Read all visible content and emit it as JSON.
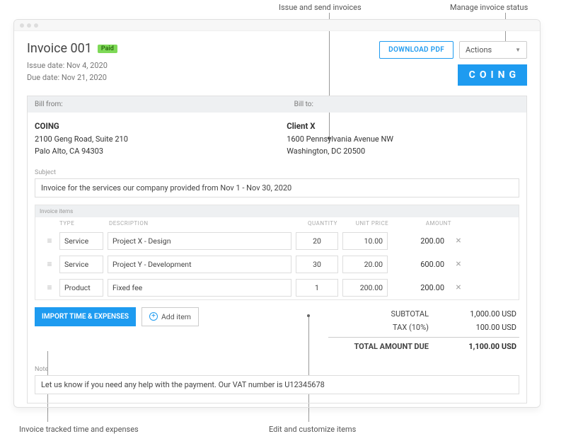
{
  "annotations": {
    "issue_send": "Issue and send invoices",
    "manage_status": "Manage invoice status",
    "tracked": "Invoice tracked time and expenses",
    "edit_items": "Edit and customize items"
  },
  "header": {
    "title": "Invoice 001",
    "status_badge": "Paid",
    "issue_date": "Issue date: Nov 4, 2020",
    "due_date": "Due date: Nov 21, 2020",
    "download_label": "DOWNLOAD PDF",
    "actions_label": "Actions",
    "logo": "COING"
  },
  "bill": {
    "from_label": "Bill from:",
    "to_label": "Bill to:",
    "from_name": "COING",
    "from_line1": "2100 Geng Road, Suite 210",
    "from_line2": "Palo Alto, CA 94303",
    "to_name": "Client X",
    "to_line1": "1600 Pennsylvania Avenue NW",
    "to_line2": "Washington, DC 20500"
  },
  "subject": {
    "label": "Subject",
    "value": "Invoice for the services our company provided from Nov 1 - Nov 30, 2020"
  },
  "items": {
    "section_label": "Invoice items",
    "cols": {
      "type": "TYPE",
      "desc": "DESCRIPTION",
      "qty": "QUANTITY",
      "price": "UNIT PRICE",
      "amt": "AMOUNT"
    },
    "rows": [
      {
        "type": "Service",
        "desc": "Project X - Design",
        "qty": "20",
        "price": "10.00",
        "amt": "200.00"
      },
      {
        "type": "Service",
        "desc": "Project Y - Development",
        "qty": "30",
        "price": "20.00",
        "amt": "600.00"
      },
      {
        "type": "Product",
        "desc": "Fixed fee",
        "qty": "1",
        "price": "200.00",
        "amt": "200.00"
      }
    ]
  },
  "buttons": {
    "import": "IMPORT TIME & EXPENSES",
    "add_item": "Add item"
  },
  "totals": {
    "subtotal_label": "SUBTOTAL",
    "subtotal": "1,000.00 USD",
    "tax_label": "TAX  (10%)",
    "tax": "100.00 USD",
    "total_label": "TOTAL AMOUNT DUE",
    "total": "1,100.00 USD"
  },
  "note": {
    "label": "Note",
    "value": "Let us know if you need any help with the payment. Our VAT number is U12345678"
  }
}
